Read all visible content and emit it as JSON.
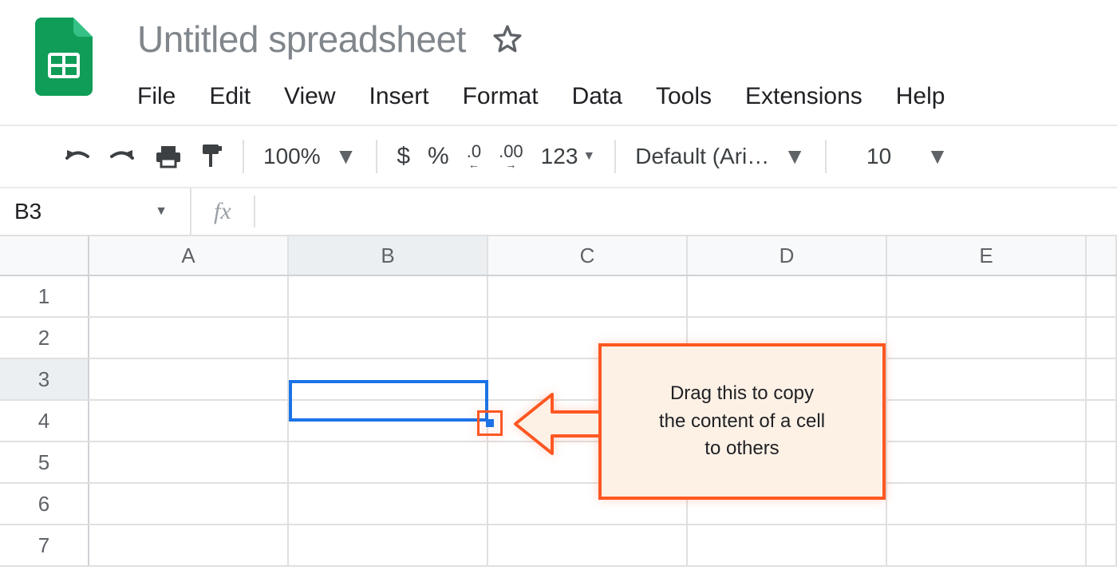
{
  "header": {
    "doc_title": "Untitled spreadsheet"
  },
  "menu": {
    "file": "File",
    "edit": "Edit",
    "view": "View",
    "insert": "Insert",
    "format": "Format",
    "data": "Data",
    "tools": "Tools",
    "extensions": "Extensions",
    "help": "Help"
  },
  "toolbar": {
    "zoom": "100%",
    "currency": "$",
    "percent": "%",
    "dec_dec": ".0",
    "inc_dec": ".00",
    "more_formats": "123",
    "font": "Default (Ari…",
    "font_size": "10"
  },
  "formula": {
    "name_box": "B3",
    "fx_label": "fx"
  },
  "grid": {
    "columns": [
      "A",
      "B",
      "C",
      "D",
      "E"
    ],
    "rows": [
      "1",
      "2",
      "3",
      "4",
      "5",
      "6",
      "7"
    ],
    "selected_cell": "B3"
  },
  "callout": {
    "line1": "Drag this to copy",
    "line2": "the content of a cell",
    "line3": "to others"
  }
}
